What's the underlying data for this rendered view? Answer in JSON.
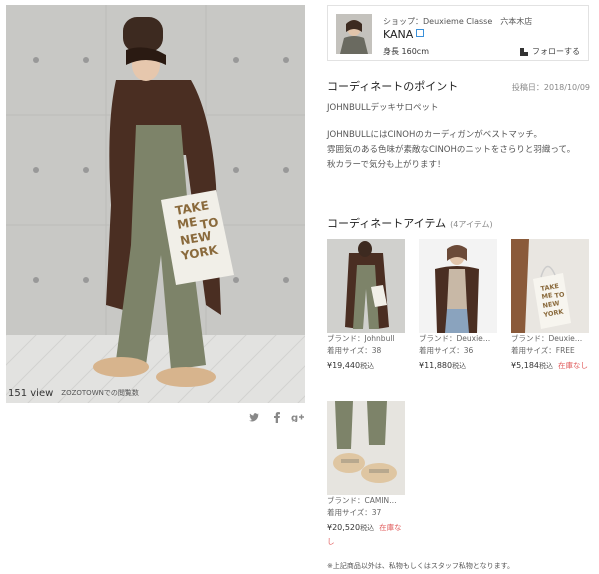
{
  "post": {
    "view_count": "151 view",
    "view_note": "ZOZOTOWNでの閲覧数",
    "share_icons": [
      "twitter-icon",
      "facebook-icon",
      "google-plus-icon"
    ],
    "photo_bag_text": [
      "TAKE",
      "ME",
      "TO",
      "NEW",
      "YORK"
    ]
  },
  "shop": {
    "name": "ショップ：Deuxieme Classe　六本木店",
    "staff_name": "KANA",
    "height": "身長 160cm",
    "follow_label": "フォローする",
    "accent_color": "#3a90d9"
  },
  "point": {
    "title": "コーディネートのポイント",
    "date": "投稿日：2018/10/09",
    "subtitle": "JOHNBULLデッキサロペット",
    "lines": [
      "JOHNBULLにはCINOHのカーディガンがベストマッチ。",
      "雰囲気のある色味が素敵なCINOHのニットをさらりと羽織って。",
      "秋カラーで気分も上がります！"
    ]
  },
  "items_section": {
    "title": "コーディネートアイテム",
    "count": "(4アイテム)",
    "note": "※上記商品以外は、私物もしくはスタッフ私物となります。"
  },
  "items": [
    {
      "brand": "ブランド：Johnbull",
      "size": "着用サイズ：38",
      "price": "¥19,440",
      "tax": "税込",
      "stock": ""
    },
    {
      "brand": "ブランド：Deuxie…",
      "size": "着用サイズ：36",
      "price": "¥11,880",
      "tax": "税込",
      "stock": ""
    },
    {
      "brand": "ブランド：Deuxie…",
      "size": "着用サイズ：FREE",
      "price": "¥5,184",
      "tax": "税込",
      "stock": "在庫なし"
    },
    {
      "brand": "ブランド：CAMIN…",
      "size": "着用サイズ：37",
      "price": "¥20,520",
      "tax": "税込",
      "stock": "在庫なし"
    }
  ],
  "colors": {
    "stock_out": "#e05a5a",
    "wall": "#c9c9c6",
    "cardigan": "#4a2e22",
    "pants": "#7d8369"
  }
}
